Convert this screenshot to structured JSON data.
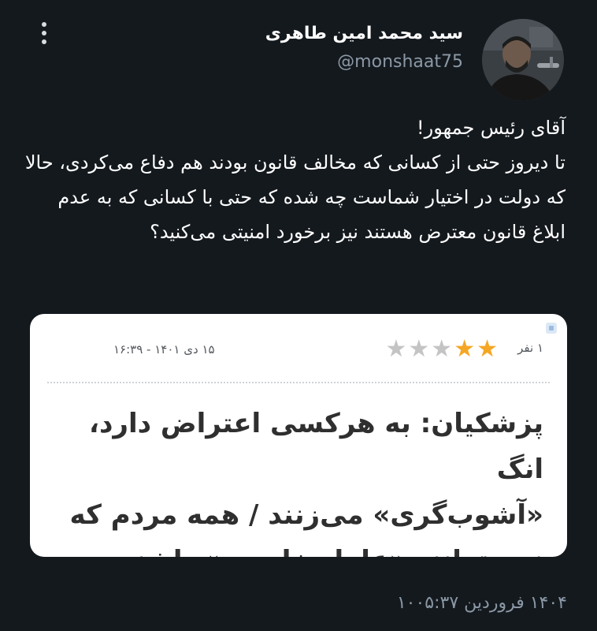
{
  "author": {
    "name": "سید محمد امین طاهری",
    "handle": "@monshaat75"
  },
  "tweet": {
    "text": "آقای رئیس جمهور!\nتا دیروز حتی از کسانی که مخالف قانون بودند هم دفاع می‌کردی، حالا که دولت در اختیار شماست چه شده که حتی با کسانی که به عدم ابلاغ قانون معترض هستند نیز برخورد امنیتی می‌کنید؟"
  },
  "card": {
    "rating_label": "۱ نفر",
    "rating": 2,
    "rating_max": 5,
    "date": "۱۵ دی ۱۴۰۱ - ۱۶:۳۹",
    "headline": "پزشکیان: به هرکسی اعتراض دارد، انگ\n«آشوب‌گری» می‌زنند / همه مردم که\nنمی‌توانند «عامل خارجی» باشند",
    "star_on_color": "#f5a623",
    "star_off_color": "#c4c4c4"
  },
  "footer": {
    "timestamp": "۱۴۰۴ فروردین ۱۰۰۵:۳۷"
  },
  "icons": {
    "more": "more-options-icon",
    "avatar": "avatar",
    "star": "star-icon"
  }
}
